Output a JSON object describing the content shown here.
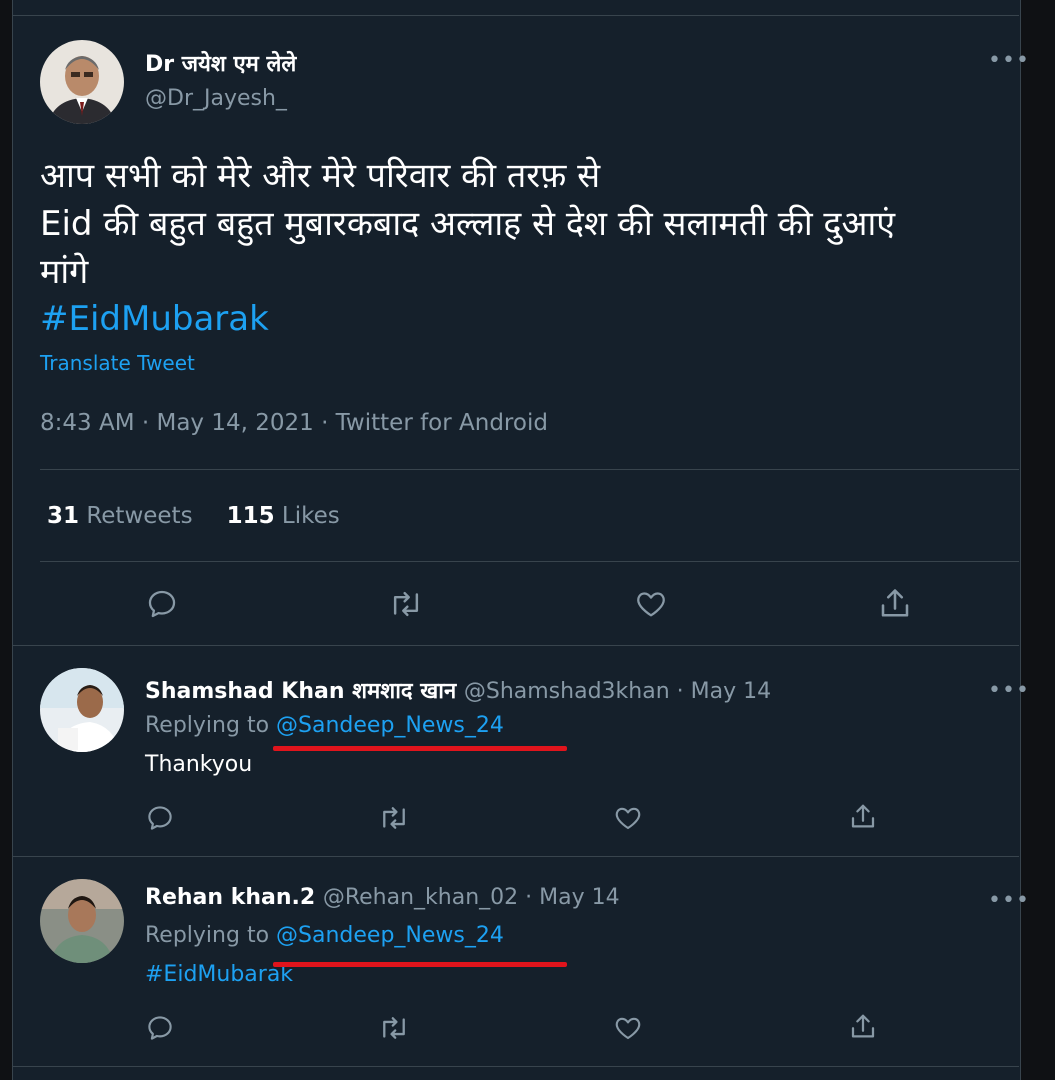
{
  "main_tweet": {
    "author_name": "Dr जयेश एम लेले",
    "author_handle": "@Dr_Jayesh_",
    "text_line1": "आप सभी को मेरे और मेरे परिवार की तरफ़ से",
    "text_line2": "Eid की बहुत बहुत मुबारकबाद अल्लाह से देश की सलामती की दुआएं",
    "text_line3": "मांगे",
    "hashtag": "#EidMubarak",
    "translate_label": "Translate Tweet",
    "meta": "8:43 AM · May 14, 2021 · Twitter for Android",
    "retweets_count": "31",
    "retweets_label": "Retweets",
    "likes_count": "115",
    "likes_label": "Likes"
  },
  "replies": [
    {
      "name": "Shamshad Khan शमशाद खान",
      "meta": "@Shamshad3khan · May 14",
      "replying_prefix": "Replying to",
      "replying_to": "@Sandeep_News_24",
      "text": "Thankyou"
    },
    {
      "name": "Rehan khan.2",
      "meta": "@Rehan_khan_02 · May 14",
      "replying_prefix": "Replying to",
      "replying_to": "@Sandeep_News_24",
      "text": "#EidMubarak"
    }
  ],
  "icons": [
    "more-icon",
    "reply-icon",
    "retweet-icon",
    "like-icon",
    "share-icon"
  ],
  "colors": {
    "background": "#15202b",
    "link": "#1da1f2",
    "muted": "#8899a6",
    "annotation": "#e0141c"
  }
}
